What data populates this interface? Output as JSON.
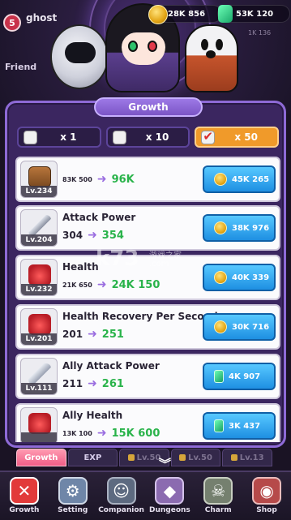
{
  "header": {
    "level": "5",
    "player_name": "ghost",
    "exp_text": "",
    "friend_label": "Friend",
    "gold": "28K 856",
    "gems": "53K 120",
    "sub_gold": "",
    "sub_gems": "1K 136"
  },
  "panel": {
    "title": "Growth",
    "multipliers": [
      {
        "label": "x 1",
        "active": false
      },
      {
        "label": "x 10",
        "active": false
      },
      {
        "label": "x 50",
        "active": true
      }
    ]
  },
  "items": [
    {
      "name": "",
      "level": "Lv.234",
      "current": "83K 500",
      "next": "96K",
      "cost": "45K 265",
      "currency": "gold",
      "art": "chest"
    },
    {
      "name": "Attack Power",
      "level": "Lv.204",
      "current": "304",
      "next": "354",
      "cost": "38K 976",
      "currency": "gold",
      "art": "sword"
    },
    {
      "name": "Health",
      "level": "Lv.232",
      "current": "21K 650",
      "next": "24K 150",
      "cost": "40K 339",
      "currency": "gold",
      "art": "heart"
    },
    {
      "name": "Health Recovery Per Second",
      "level": "Lv.201",
      "current": "201",
      "next": "251",
      "cost": "30K 716",
      "currency": "gold",
      "art": "heart-plus"
    },
    {
      "name": "Ally Attack Power",
      "level": "Lv.111",
      "current": "211",
      "next": "261",
      "cost": "4K 907",
      "currency": "gem",
      "art": "ghost-sword"
    },
    {
      "name": "Ally Health",
      "level": "",
      "current": "13K 100",
      "next": "15K 600",
      "cost": "3K 437",
      "currency": "gem",
      "art": "ghost-heart"
    }
  ],
  "tabs": [
    {
      "label": "Growth",
      "active": true,
      "locked": false
    },
    {
      "label": "EXP",
      "active": false,
      "locked": false
    },
    {
      "label": "Lv.50",
      "active": false,
      "locked": true
    },
    {
      "label": "Lv.50",
      "active": false,
      "locked": true
    },
    {
      "label": "Lv.13",
      "active": false,
      "locked": true
    }
  ],
  "nav": [
    {
      "label": "Growth",
      "icon": "close-icon",
      "glyph": "✕"
    },
    {
      "label": "Setting",
      "icon": "gear-icon",
      "glyph": "⚙"
    },
    {
      "label": "Companion",
      "icon": "companion-icon",
      "glyph": "☺"
    },
    {
      "label": "Dungeons",
      "icon": "dungeon-icon",
      "glyph": "◆"
    },
    {
      "label": "Charm",
      "icon": "charm-icon",
      "glyph": "☠"
    },
    {
      "label": "Shop",
      "icon": "shop-icon",
      "glyph": "◉"
    }
  ],
  "watermark": {
    "logo": "k73",
    "site_name": "游戏之家",
    "url": ".com"
  },
  "colors": {
    "accent": "#8e6ad6",
    "gold": "#e2a414",
    "gem": "#1aa86a",
    "buy_button": "#1e8fe2",
    "active_tab": "#f05e86",
    "active_multiplier": "#f09a2a"
  }
}
